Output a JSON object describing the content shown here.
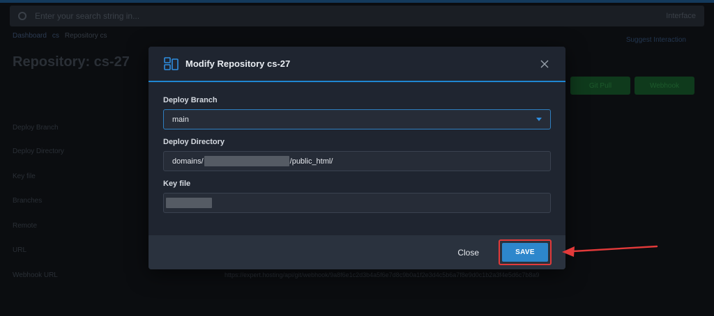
{
  "background": {
    "search_placeholder": "Enter your search string in...",
    "user_label": "Interface",
    "breadcrumb": [
      "Dashboard",
      "cs",
      "Repository cs"
    ],
    "page_title": "Repository: cs-27",
    "right_link": "Suggest Interaction",
    "buttons": [
      "Git Pull",
      "Webhook"
    ],
    "labels": [
      "Deploy Branch",
      "Deploy Directory",
      "Key file",
      "Branches",
      "Remote",
      "URL",
      "Webhook URL"
    ],
    "webhook_value": "https://expert.hosting/api/git/webhook/9a8f6e1c2d3b4a5f6e7d8c9b0a1f2e3d4c5b6a7f8e9d0c1b2a3f4e5d6c7b8a9"
  },
  "modal": {
    "icon": "repository-icon",
    "title": "Modify Repository cs-27",
    "close_icon": "close-icon",
    "fields": {
      "deploy_branch": {
        "label": "Deploy Branch",
        "value": "main"
      },
      "deploy_directory": {
        "label": "Deploy Directory",
        "prefix": "domains/",
        "suffix": "/public_html/"
      },
      "key_file": {
        "label": "Key file"
      }
    },
    "footer": {
      "close_label": "Close",
      "save_label": "SAVE"
    }
  },
  "colors": {
    "accent": "#1f86d1",
    "save_button": "#2d87cc",
    "highlight": "#e23a3a"
  }
}
